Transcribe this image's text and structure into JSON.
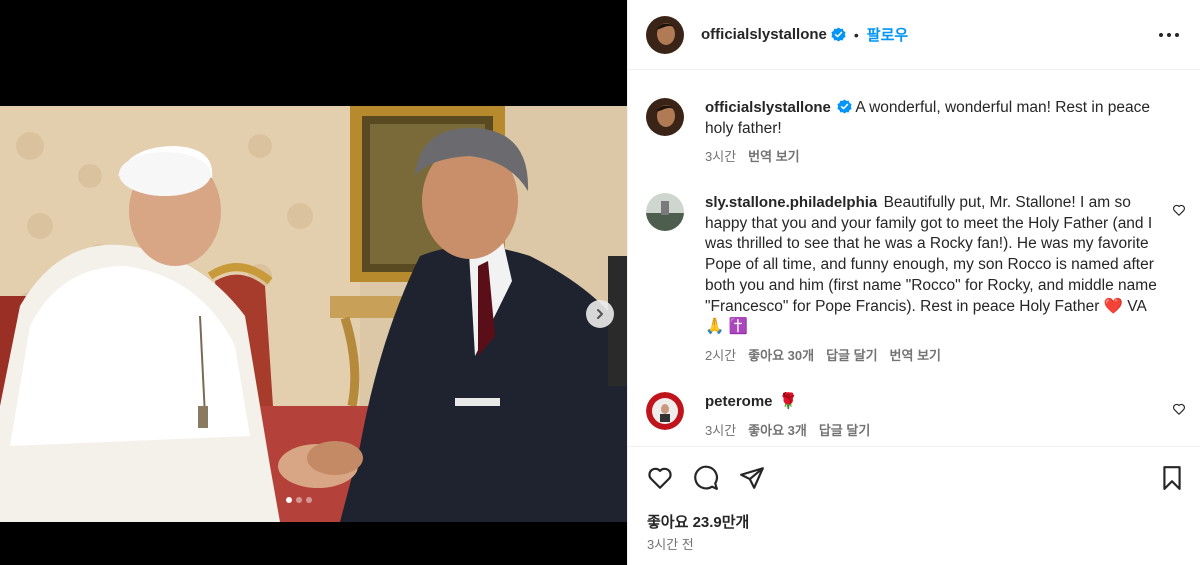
{
  "post": {
    "username": "officialslystallone",
    "follow_label": "팔로우",
    "bullet": "•",
    "likes": "좋아요 23.9만개",
    "time": "3시간 전"
  },
  "comments": [
    {
      "username": "officialslystallone",
      "text": "A wonderful, wonderful man! Rest in peace holy father!",
      "time": "3시간",
      "actions": [
        "번역 보기"
      ]
    },
    {
      "username": "sly.stallone.philadelphia",
      "text": "Beautifully put, Mr. Stallone! I am so happy that you and your family got to meet the Holy Father (and I was thrilled to see that he was a Rocky fan!). He was my favorite Pope of all time, and funny enough, my son Rocco is named after both you and him (first name \"Rocco\" for Rocky, and middle name \"Francesco\" for Pope Francis). Rest in peace Holy Father ❤️ VA 🙏 ✝️",
      "time": "2시간",
      "actions": [
        "좋아요 30개",
        "답글 달기",
        "번역 보기"
      ]
    },
    {
      "username": "peterome",
      "text": "🌹",
      "time": "3시간",
      "actions": [
        "좋아요 3개",
        "답글 달기"
      ]
    }
  ],
  "carousel": {
    "slide_count": 3,
    "active_index": 0
  },
  "icons": {
    "verified": "verified-badge-icon",
    "more": "more-options-icon",
    "like": "heart-icon",
    "comment": "comment-icon",
    "share": "share-icon",
    "save": "bookmark-icon",
    "next": "chevron-right-icon"
  },
  "colors": {
    "link_blue": "#0095f6",
    "text": "#262626",
    "secondary": "#737373",
    "divider": "#efefef"
  }
}
